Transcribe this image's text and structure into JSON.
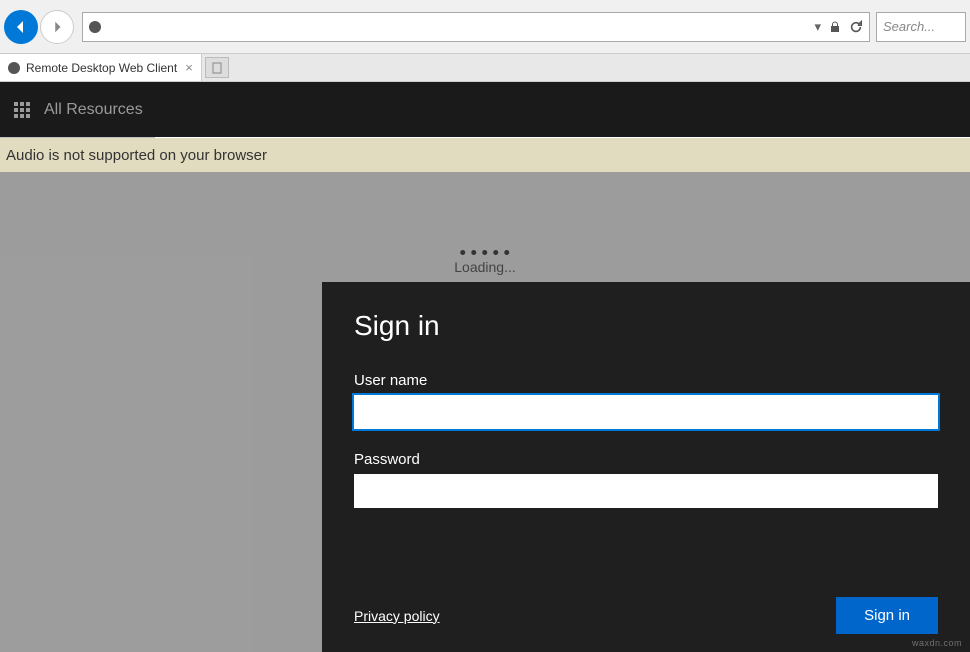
{
  "browser": {
    "search_placeholder": "Search...",
    "dropdown_indicator": "▾",
    "refresh_icon_name": "refresh-icon",
    "lock_icon_name": "lock-icon"
  },
  "tab": {
    "title": "Remote Desktop Web Client",
    "close_label": "×"
  },
  "header": {
    "title": "All Resources"
  },
  "banner": {
    "message": "Audio is not supported on your browser"
  },
  "loading": {
    "text": "Loading..."
  },
  "signin": {
    "title": "Sign in",
    "username_label": "User name",
    "username_value": "",
    "password_label": "Password",
    "password_value": "",
    "privacy_label": "Privacy policy",
    "button_label": "Sign in"
  },
  "watermark": "waxdn.com"
}
